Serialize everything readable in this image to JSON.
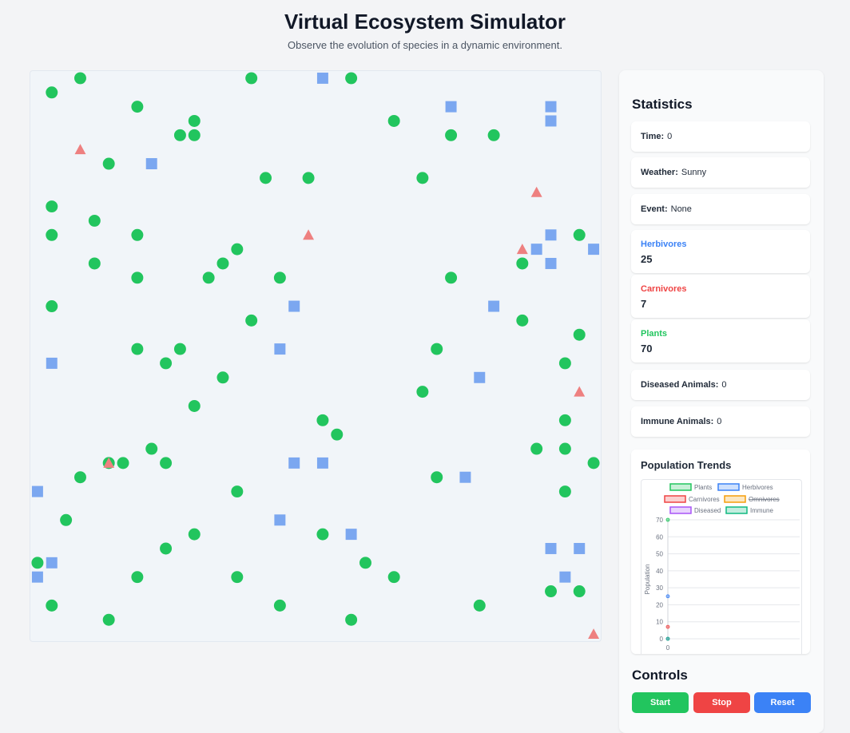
{
  "header": {
    "title": "Virtual Ecosystem Simulator",
    "subtitle": "Observe the evolution of species in a dynamic environment."
  },
  "colors": {
    "plant": "#22c55e",
    "herbivore": "#7ba7f0",
    "carnivore": "#ee8080",
    "canvas_bg": "#f1f5f9",
    "diseased": "#a855f7",
    "immune": "#10b981",
    "omnivore": "#f59e0b"
  },
  "stats": {
    "heading": "Statistics",
    "time_label": "Time:",
    "time_value": "0",
    "weather_label": "Weather:",
    "weather_value": "Sunny",
    "event_label": "Event:",
    "event_value": "None",
    "herbivores_label": "Herbivores",
    "herbivores_value": "25",
    "carnivores_label": "Carnivores",
    "carnivores_value": "7",
    "plants_label": "Plants",
    "plants_value": "70",
    "diseased_label": "Diseased Animals:",
    "diseased_value": "0",
    "immune_label": "Immune Animals:",
    "immune_value": "0"
  },
  "chart_heading": "Population Trends",
  "controls": {
    "heading": "Controls",
    "start_label": "Start",
    "stop_label": "Stop",
    "reset_label": "Reset"
  },
  "ecosystem": {
    "grid_columns": 40,
    "grid_rows": 40,
    "plants": [
      [
        1,
        1
      ],
      [
        3,
        0
      ],
      [
        7,
        2
      ],
      [
        11,
        3
      ],
      [
        10,
        4
      ],
      [
        11,
        4
      ],
      [
        5,
        6
      ],
      [
        1,
        9
      ],
      [
        4,
        10
      ],
      [
        1,
        11
      ],
      [
        7,
        11
      ],
      [
        14,
        12
      ],
      [
        13,
        13
      ],
      [
        4,
        13
      ],
      [
        7,
        14
      ],
      [
        12,
        14
      ],
      [
        17,
        14
      ],
      [
        1,
        16
      ],
      [
        15,
        17
      ],
      [
        7,
        19
      ],
      [
        10,
        19
      ],
      [
        13,
        21
      ],
      [
        9,
        20
      ],
      [
        16,
        7
      ],
      [
        15,
        0
      ],
      [
        22,
        0
      ],
      [
        25,
        3
      ],
      [
        29,
        4
      ],
      [
        32,
        4
      ],
      [
        19,
        7
      ],
      [
        27,
        7
      ],
      [
        29,
        14
      ],
      [
        34,
        13
      ],
      [
        38,
        11
      ],
      [
        34,
        17
      ],
      [
        38,
        18
      ],
      [
        37,
        20
      ],
      [
        28,
        19
      ],
      [
        11,
        23
      ],
      [
        27,
        22
      ],
      [
        20,
        24
      ],
      [
        21,
        25
      ],
      [
        37,
        24
      ],
      [
        35,
        26
      ],
      [
        37,
        26
      ],
      [
        39,
        27
      ],
      [
        28,
        28
      ],
      [
        37,
        29
      ],
      [
        8,
        26
      ],
      [
        6,
        27
      ],
      [
        9,
        27
      ],
      [
        3,
        28
      ],
      [
        5,
        27
      ],
      [
        14,
        29
      ],
      [
        2,
        31
      ],
      [
        11,
        32
      ],
      [
        20,
        32
      ],
      [
        9,
        33
      ],
      [
        0,
        34
      ],
      [
        23,
        34
      ],
      [
        7,
        35
      ],
      [
        14,
        35
      ],
      [
        25,
        35
      ],
      [
        36,
        36
      ],
      [
        38,
        36
      ],
      [
        1,
        37
      ],
      [
        17,
        37
      ],
      [
        31,
        37
      ],
      [
        5,
        38
      ],
      [
        22,
        38
      ]
    ],
    "herbivores": [
      [
        20,
        0
      ],
      [
        29,
        2
      ],
      [
        36,
        2
      ],
      [
        36,
        3
      ],
      [
        8,
        6
      ],
      [
        36,
        11
      ],
      [
        35,
        12
      ],
      [
        36,
        13
      ],
      [
        39,
        12
      ],
      [
        18,
        16
      ],
      [
        32,
        16
      ],
      [
        17,
        19
      ],
      [
        1,
        20
      ],
      [
        31,
        21
      ],
      [
        18,
        27
      ],
      [
        20,
        27
      ],
      [
        30,
        28
      ],
      [
        0,
        29
      ],
      [
        17,
        31
      ],
      [
        22,
        32
      ],
      [
        36,
        33
      ],
      [
        38,
        33
      ],
      [
        1,
        34
      ],
      [
        0,
        35
      ],
      [
        37,
        35
      ]
    ],
    "carnivores": [
      [
        3,
        5
      ],
      [
        35,
        8
      ],
      [
        19,
        11
      ],
      [
        34,
        12
      ],
      [
        38,
        22
      ],
      [
        5,
        27
      ],
      [
        39,
        39
      ]
    ]
  },
  "chart_data": {
    "type": "line",
    "xlabel": "",
    "ylabel": "Population",
    "x": [
      0
    ],
    "ylim": [
      0,
      70
    ],
    "yticks": [
      0,
      10,
      20,
      30,
      40,
      50,
      60,
      70
    ],
    "xticks": [
      0
    ],
    "grid": true,
    "legend_position": "top",
    "series": [
      {
        "name": "Plants",
        "values": [
          70
        ],
        "color": "#22c55e",
        "hidden": false
      },
      {
        "name": "Herbivores",
        "values": [
          25
        ],
        "color": "#3b82f6",
        "hidden": false
      },
      {
        "name": "Carnivores",
        "values": [
          7
        ],
        "color": "#ef4444",
        "hidden": false
      },
      {
        "name": "Omnivores",
        "values": [
          0
        ],
        "color": "#f59e0b",
        "hidden": true
      },
      {
        "name": "Diseased",
        "values": [
          0
        ],
        "color": "#a855f7",
        "hidden": false
      },
      {
        "name": "Immune",
        "values": [
          0
        ],
        "color": "#10b981",
        "hidden": false
      }
    ]
  }
}
